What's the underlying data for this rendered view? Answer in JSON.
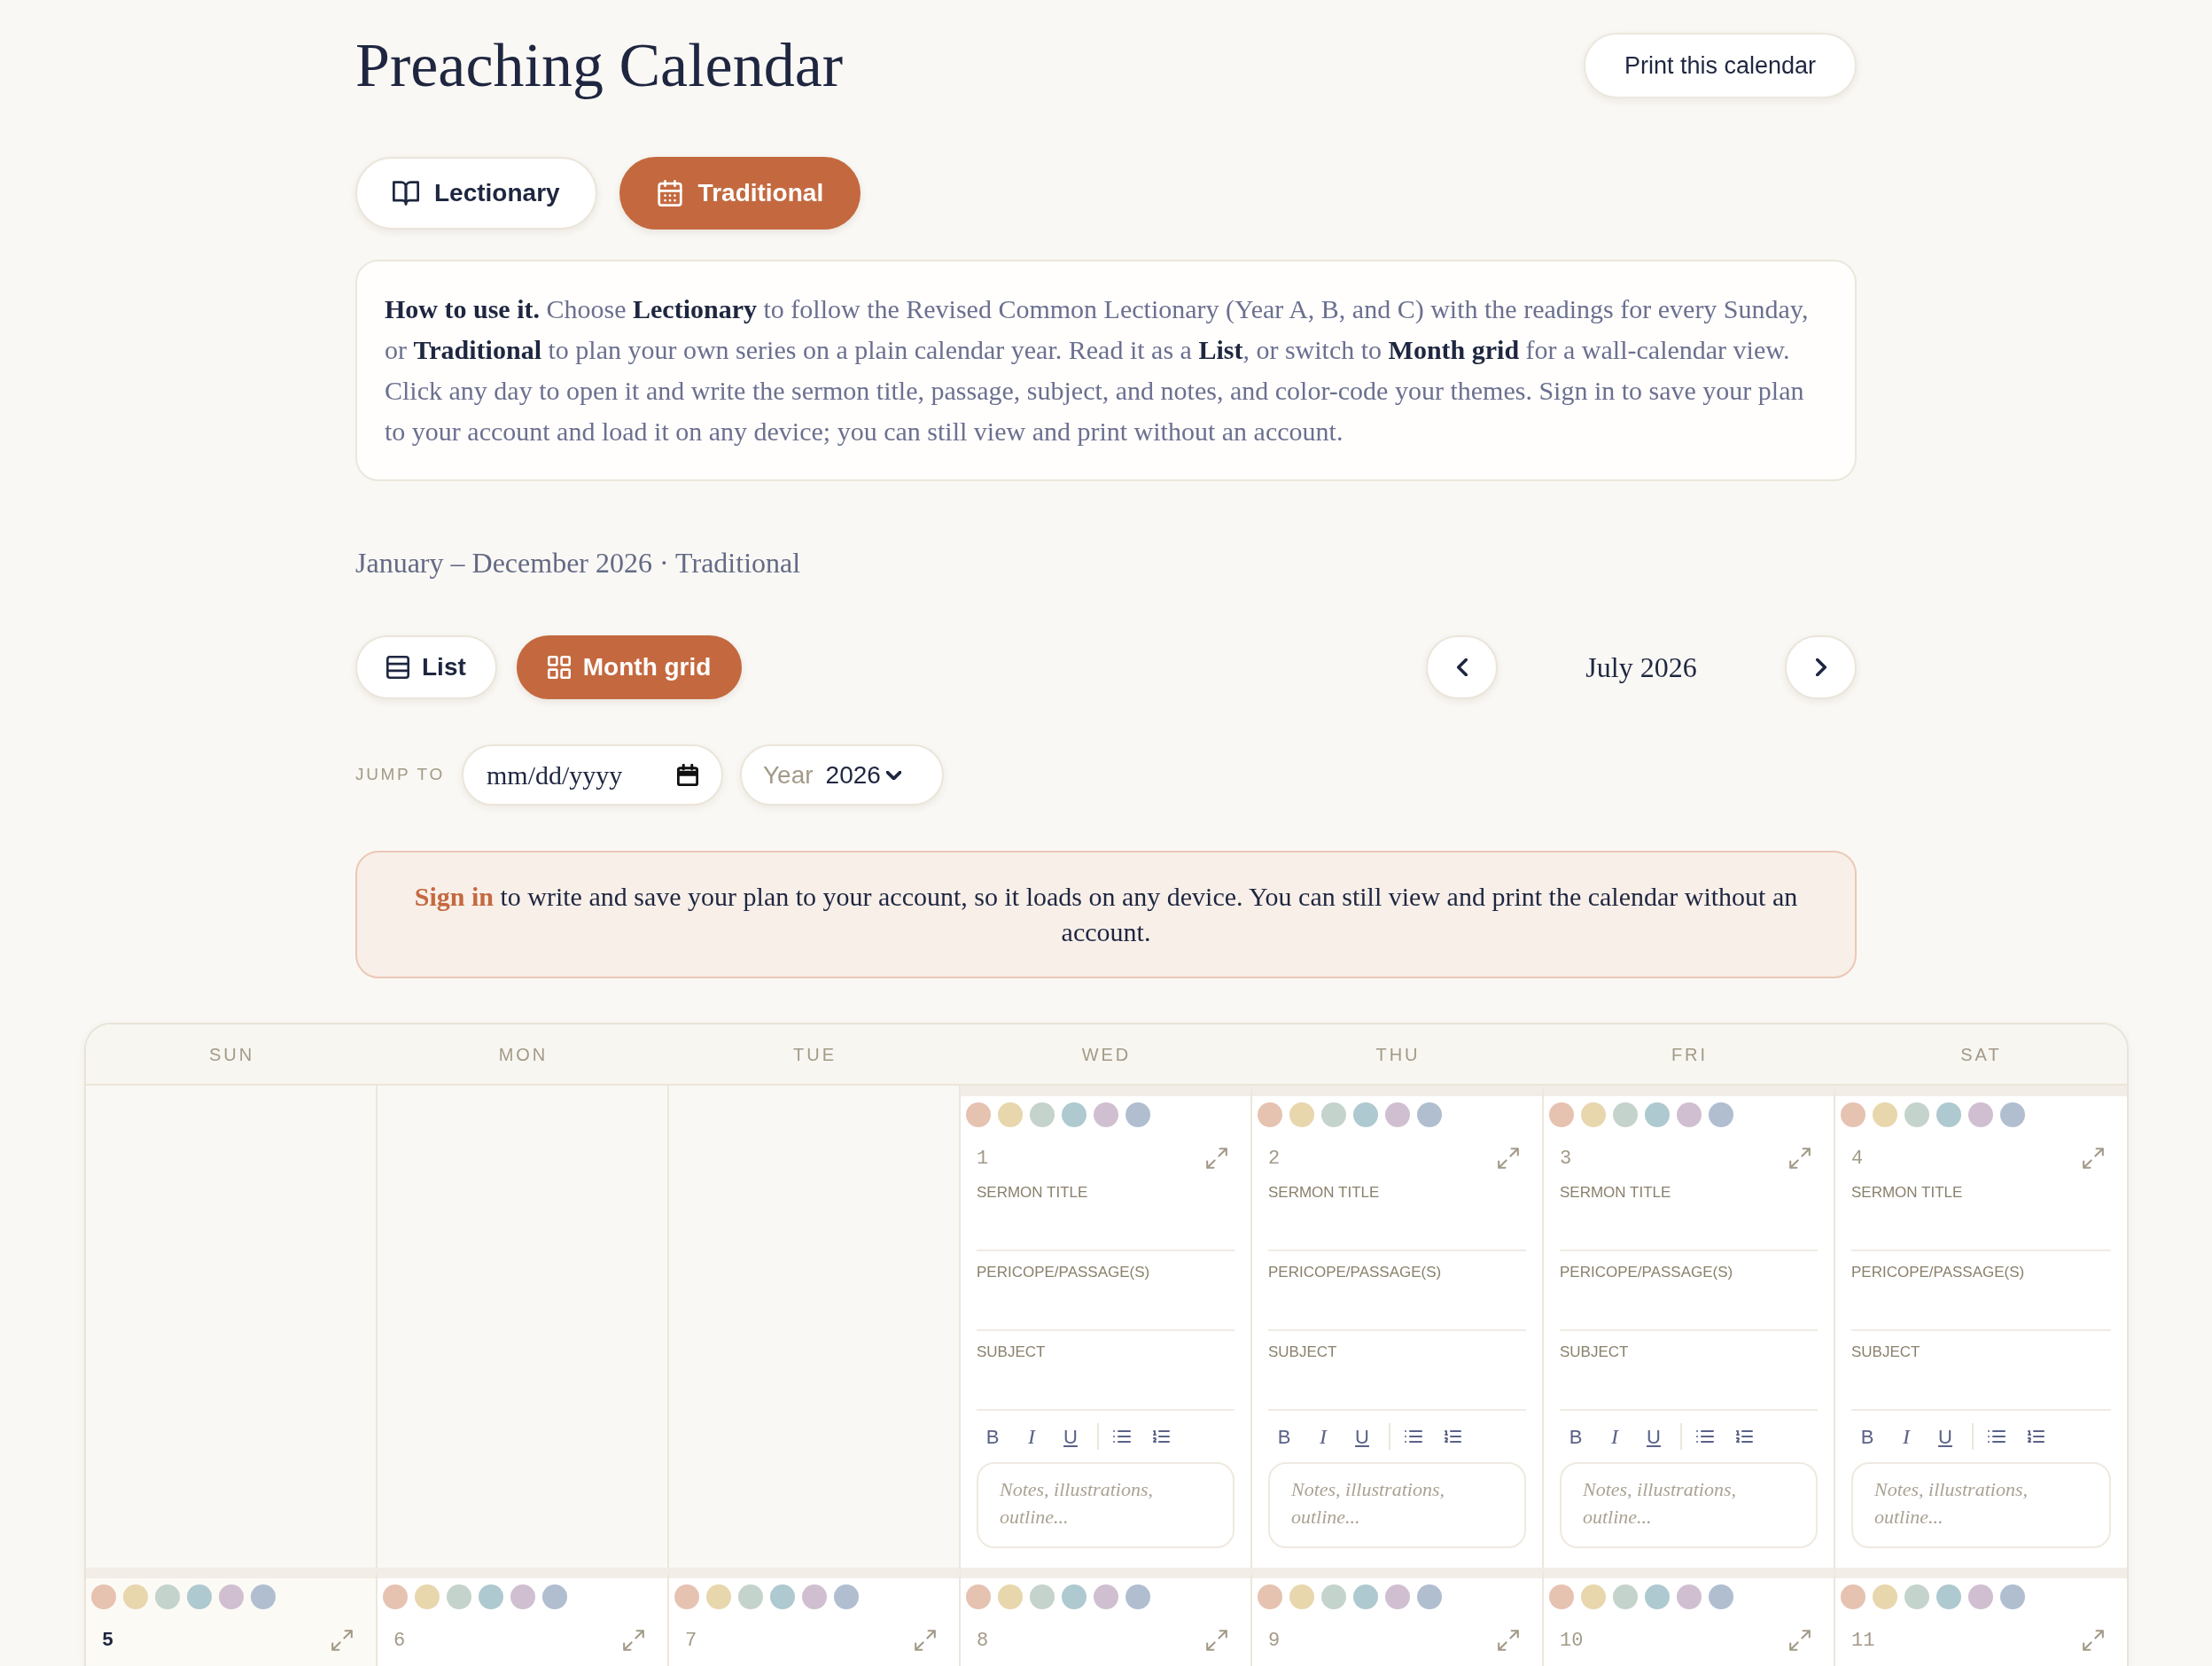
{
  "header": {
    "title": "Preaching Calendar",
    "print_button": "Print this calendar"
  },
  "modes": [
    {
      "label": "Lectionary",
      "selected": false
    },
    {
      "label": "Traditional",
      "selected": true
    }
  ],
  "intro": {
    "text": "**How to use it.** Choose **Lectionary** to follow the Revised Common Lectionary (Year A, B, and C) with the readings for every Sunday, or **Traditional** to plan your own series on a plain calendar year. Read it as a **List**, or switch to **Month grid** for a wall-calendar view. Click any day to open it and write the sermon title, passage, subject, and notes, and color-code your themes. Sign in to save your plan to your account and load it on any device; you can still view and print without an account."
  },
  "range_label": "January – December 2026 · Traditional",
  "views": [
    {
      "label": "List",
      "selected": false
    },
    {
      "label": "Month grid",
      "selected": true
    }
  ],
  "month_nav": {
    "label": "July 2026"
  },
  "jump_to": {
    "label": "JUMP TO",
    "date_field": {
      "placeholder": "mm/dd/yyyy"
    },
    "year_select": {
      "label": "Year",
      "value": "2026"
    }
  },
  "notice": {
    "link": "Sign in",
    "text": "to write and save your plan to your account, so it loads on any device. You can still view and print the calendar without an account."
  },
  "calendar": {
    "weekdays": [
      "SUN",
      "MON",
      "TUE",
      "WED",
      "THU",
      "FRI",
      "SAT"
    ],
    "weeks": [
      {
        "days": [
          {
            "kind": "blank"
          },
          {
            "kind": "blank"
          },
          {
            "kind": "blank"
          },
          {
            "kind": "day",
            "date": "1",
            "emphasized": false,
            "swatches": [
              {
                "color": "#e6c2b1",
                "selected": false
              },
              {
                "color": "#e8d6ad",
                "selected": false
              },
              {
                "color": "#c4d3cb",
                "selected": false
              },
              {
                "color": "#aec9cf",
                "selected": false
              },
              {
                "color": "#d0bfd1",
                "selected": false
              },
              {
                "color": "#b0bed0",
                "selected": false
              }
            ],
            "fields": [
              {
                "label": "SERMON TITLE"
              },
              {
                "label": "PERICOPE/PASSAGE(S)"
              },
              {
                "label": "SUBJECT"
              }
            ],
            "format_buttons": [
              "B",
              "I",
              "U"
            ],
            "notes": {
              "placeholder": "Notes, illustrations, outline..."
            }
          },
          {
            "kind": "day",
            "date": "2",
            "emphasized": false,
            "swatches": [
              {
                "color": "#e6c2b1",
                "selected": false
              },
              {
                "color": "#e8d6ad",
                "selected": false
              },
              {
                "color": "#c4d3cb",
                "selected": false
              },
              {
                "color": "#aec9cf",
                "selected": false
              },
              {
                "color": "#d0bfd1",
                "selected": false
              },
              {
                "color": "#b0bed0",
                "selected": false
              }
            ],
            "fields": [
              {
                "label": "SERMON TITLE"
              },
              {
                "label": "PERICOPE/PASSAGE(S)"
              },
              {
                "label": "SUBJECT"
              }
            ],
            "format_buttons": [
              "B",
              "I",
              "U"
            ],
            "notes": {
              "placeholder": "Notes, illustrations, outline..."
            }
          },
          {
            "kind": "day",
            "date": "3",
            "emphasized": false,
            "swatches": [
              {
                "color": "#e6c2b1",
                "selected": false
              },
              {
                "color": "#e8d6ad",
                "selected": false
              },
              {
                "color": "#c4d3cb",
                "selected": false
              },
              {
                "color": "#aec9cf",
                "selected": false
              },
              {
                "color": "#d0bfd1",
                "selected": false
              },
              {
                "color": "#b0bed0",
                "selected": false
              }
            ],
            "fields": [
              {
                "label": "SERMON TITLE"
              },
              {
                "label": "PERICOPE/PASSAGE(S)"
              },
              {
                "label": "SUBJECT"
              }
            ],
            "format_buttons": [
              "B",
              "I",
              "U"
            ],
            "notes": {
              "placeholder": "Notes, illustrations, outline..."
            }
          },
          {
            "kind": "day",
            "date": "4",
            "emphasized": false,
            "swatches": [
              {
                "color": "#e6c2b1",
                "selected": false
              },
              {
                "color": "#e8d6ad",
                "selected": false
              },
              {
                "color": "#c4d3cb",
                "selected": false
              },
              {
                "color": "#aec9cf",
                "selected": false
              },
              {
                "color": "#d0bfd1",
                "selected": false
              },
              {
                "color": "#b0bed0",
                "selected": false
              }
            ],
            "fields": [
              {
                "label": "SERMON TITLE"
              },
              {
                "label": "PERICOPE/PASSAGE(S)"
              },
              {
                "label": "SUBJECT"
              }
            ],
            "format_buttons": [
              "B",
              "I",
              "U"
            ],
            "notes": {
              "placeholder": "Notes, illustrations, outline..."
            }
          }
        ]
      },
      {
        "days": [
          {
            "kind": "day",
            "date": "5",
            "emphasized": true,
            "swatches": [
              {
                "color": "#e6c2b1",
                "selected": false
              },
              {
                "color": "#e8d6ad",
                "selected": false
              },
              {
                "color": "#c4d3cb",
                "selected": false
              },
              {
                "color": "#aec9cf",
                "selected": false
              },
              {
                "color": "#d0bfd1",
                "selected": false
              },
              {
                "color": "#b0bed0",
                "selected": false
              }
            ]
          },
          {
            "kind": "day",
            "date": "6",
            "emphasized": false,
            "swatches": [
              {
                "color": "#e6c2b1",
                "selected": false
              },
              {
                "color": "#e8d6ad",
                "selected": false
              },
              {
                "color": "#c4d3cb",
                "selected": false
              },
              {
                "color": "#aec9cf",
                "selected": false
              },
              {
                "color": "#d0bfd1",
                "selected": false
              },
              {
                "color": "#b0bed0",
                "selected": false
              }
            ]
          },
          {
            "kind": "day",
            "date": "7",
            "emphasized": false,
            "swatches": [
              {
                "color": "#e6c2b1",
                "selected": false
              },
              {
                "color": "#e8d6ad",
                "selected": false
              },
              {
                "color": "#c4d3cb",
                "selected": false
              },
              {
                "color": "#aec9cf",
                "selected": false
              },
              {
                "color": "#d0bfd1",
                "selected": false
              },
              {
                "color": "#b0bed0",
                "selected": false
              }
            ]
          },
          {
            "kind": "day",
            "date": "8",
            "emphasized": false,
            "swatches": [
              {
                "color": "#e6c2b1",
                "selected": false
              },
              {
                "color": "#e8d6ad",
                "selected": false
              },
              {
                "color": "#c4d3cb",
                "selected": false
              },
              {
                "color": "#aec9cf",
                "selected": false
              },
              {
                "color": "#d0bfd1",
                "selected": false
              },
              {
                "color": "#b0bed0",
                "selected": false
              }
            ]
          },
          {
            "kind": "day",
            "date": "9",
            "emphasized": false,
            "swatches": [
              {
                "color": "#e6c2b1",
                "selected": false
              },
              {
                "color": "#e8d6ad",
                "selected": false
              },
              {
                "color": "#c4d3cb",
                "selected": false
              },
              {
                "color": "#aec9cf",
                "selected": false
              },
              {
                "color": "#d0bfd1",
                "selected": false
              },
              {
                "color": "#b0bed0",
                "selected": false
              }
            ]
          },
          {
            "kind": "day",
            "date": "10",
            "emphasized": false,
            "swatches": [
              {
                "color": "#e6c2b1",
                "selected": false
              },
              {
                "color": "#e8d6ad",
                "selected": false
              },
              {
                "color": "#c4d3cb",
                "selected": false
              },
              {
                "color": "#aec9cf",
                "selected": false
              },
              {
                "color": "#d0bfd1",
                "selected": false
              },
              {
                "color": "#b0bed0",
                "selected": false
              }
            ]
          },
          {
            "kind": "day",
            "date": "11",
            "emphasized": false,
            "swatches": [
              {
                "color": "#e6c2b1",
                "selected": false
              },
              {
                "color": "#e8d6ad",
                "selected": false
              },
              {
                "color": "#c4d3cb",
                "selected": false
              },
              {
                "color": "#aec9cf",
                "selected": false
              },
              {
                "color": "#d0bfd1",
                "selected": false
              },
              {
                "color": "#b0bed0",
                "selected": false
              }
            ]
          }
        ]
      }
    ]
  }
}
